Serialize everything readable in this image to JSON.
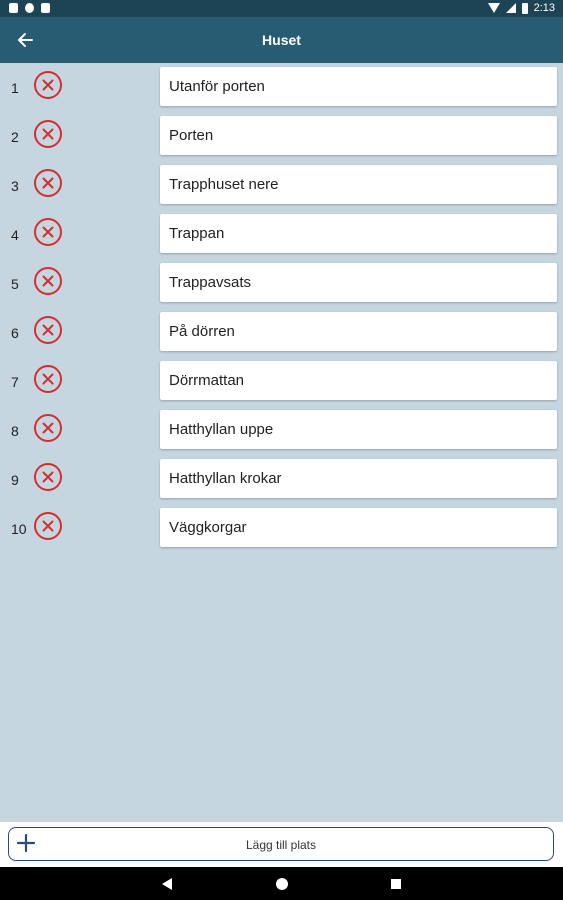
{
  "status_bar": {
    "time": "2:13"
  },
  "header": {
    "title": "Huset",
    "back_icon": "arrow-left-icon"
  },
  "places": [
    {
      "number": "1",
      "name": "Utanför porten"
    },
    {
      "number": "2",
      "name": "Porten"
    },
    {
      "number": "3",
      "name": "Trapphuset nere"
    },
    {
      "number": "4",
      "name": "Trappan"
    },
    {
      "number": "5",
      "name": "Trappavsats"
    },
    {
      "number": "6",
      "name": "På dörren"
    },
    {
      "number": "7",
      "name": "Dörrmattan"
    },
    {
      "number": "8",
      "name": "Hatthyllan uppe"
    },
    {
      "number": "9",
      "name": "Hatthyllan krokar"
    },
    {
      "number": "10",
      "name": "Väggkorgar"
    }
  ],
  "footer": {
    "add_label": "Lägg till plats"
  },
  "colors": {
    "status_bar": "#1d4454",
    "app_bar": "#275c72",
    "background": "#c6d6e1",
    "delete": "#d32f2f",
    "add_border": "#2a4a77"
  }
}
